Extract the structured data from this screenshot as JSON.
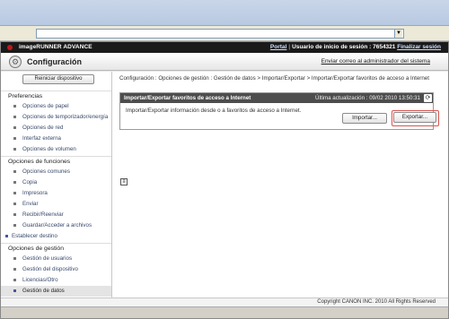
{
  "header": {
    "brand": "imageRUNNER ADVANCE",
    "portal": "Portal",
    "login_label": "Usuario de inicio de sesión : 7654321",
    "logout": "Finalizar sesión"
  },
  "titlebar": {
    "title": "Configuración",
    "email_admin": "Enviar correo al administrador del sistema"
  },
  "sidebar": {
    "reset_button": "Reiniciar dispositivo",
    "sections": [
      {
        "label": "Preferencias",
        "items": [
          "Opciones de papel",
          "Opciones de temporizador/energía",
          "Opciones de red",
          "Interfaz externa",
          "Opciones de volumen"
        ]
      },
      {
        "label": "Opciones de funciones",
        "items": [
          "Opciones comunes",
          "Copia",
          "Impresora",
          "Enviar",
          "Recibir/Reenviar",
          "Guardar/Acceder a archivos"
        ]
      },
      {
        "label": "Establecer destino",
        "items": []
      },
      {
        "label": "Opciones de gestión",
        "items": [
          "Gestión de usuarios",
          "Gestión del dispositivo",
          "Licencias/Otro",
          "Gestión de datos"
        ]
      }
    ]
  },
  "breadcrumb": "Configuración : Opciones de gestión : Gestión de datos > Importar/Exportar > Importar/Exportar favoritos de acceso a Internet",
  "panel": {
    "title": "Importar/Exportar favoritos de acceso a Internet",
    "last_update": "Última actualización : 09/02 2010 13:50:31",
    "description": "Importar/Exportar información desde o a favoritos de acceso a Internet.",
    "import_button": "Importar...",
    "export_button": "Exportar..."
  },
  "footer": {
    "copyright": "Copyright CANON INC. 2010 All Rights Reserved"
  }
}
